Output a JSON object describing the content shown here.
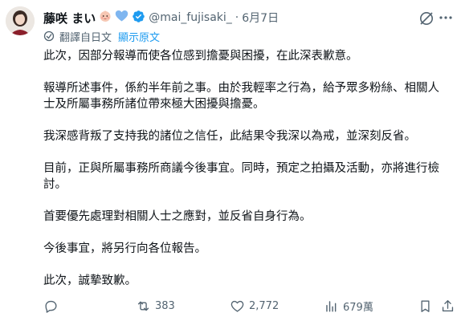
{
  "user": {
    "display_name": "藤咲 まい",
    "emojis": [
      "baby-face-emoji",
      "blue-heart-emoji"
    ],
    "handle": "@mai_fujisaki_",
    "separator": "·",
    "date": "6月7日",
    "verified": true
  },
  "translation": {
    "label": "翻譯自日文",
    "show_original": "顯示原文"
  },
  "post": {
    "paragraphs": [
      "此次，因部分報導而使各位感到擔憂與困擾，在此深表歉意。",
      "報導所述事件，係約半年前之事。由於我輕率之行為，給予眾多粉絲、相關人士及所屬事務所諸位帶來極大困擾與擔憂。",
      "我深感背叛了支持我的諸位之信任，此結果令我深以為戒，並深刻反省。",
      "目前，正與所屬事務所商議今後事宜。同時，預定之拍攝及活動，亦將進行檢討。",
      "首要優先處理對相關人士之應對，並反省自身行為。",
      "今後事宜，將另行向各位報告。",
      "此次，誠摯致歉。"
    ]
  },
  "actions": {
    "reposts": "383",
    "likes": "2,772",
    "views": "679萬"
  },
  "colors": {
    "accent": "#1d9bf0",
    "muted": "#536471",
    "text": "#0f1419"
  }
}
